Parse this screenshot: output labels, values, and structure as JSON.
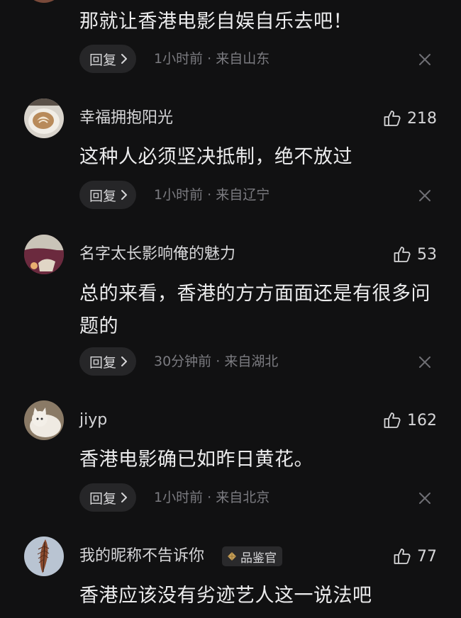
{
  "colors": {
    "background": "#111112",
    "text_primary": "#ececed",
    "text_secondary": "#7b7b80",
    "pill_background": "#262628"
  },
  "comments": [
    {
      "username": "",
      "likes": "",
      "text": "那就让香港电影自娱自乐去吧！",
      "reply_label": "回复",
      "time": "1小时前",
      "separator": "·",
      "location": "来自山东",
      "avatar_icon": "avatar-icon"
    },
    {
      "username": "幸福拥抱阳光",
      "likes": "218",
      "text": "这种人必须坚决抵制，绝不放过",
      "reply_label": "回复",
      "time": "1小时前",
      "separator": "·",
      "location": "来自辽宁",
      "avatar_icon": "coffee-latte-avatar-icon"
    },
    {
      "username": "名字太长影响俺的魅力",
      "likes": "53",
      "text": "总的来看，香港的方方面面还是有很多问题的",
      "reply_label": "回复",
      "time": "30分钟前",
      "separator": "·",
      "location": "来自湖北",
      "avatar_icon": "sunset-avatar-icon"
    },
    {
      "username": "jiyp",
      "likes": "162",
      "text": "香港电影确已如昨日黄花。",
      "reply_label": "回复",
      "time": "1小时前",
      "separator": "·",
      "location": "来自北京",
      "avatar_icon": "white-cat-avatar-icon"
    },
    {
      "username": "我的昵称不告诉你",
      "badge": "品鉴官",
      "likes": "77",
      "text": "香港应该没有劣迹艺人这一说法吧",
      "avatar_icon": "feather-avatar-icon"
    }
  ]
}
